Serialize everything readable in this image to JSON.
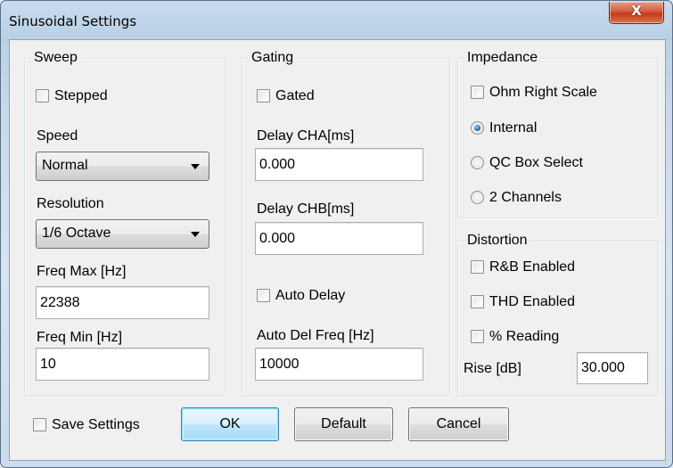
{
  "window": {
    "title": "Sinusoidal Settings",
    "close_glyph": "X"
  },
  "sweep": {
    "legend": "Sweep",
    "stepped_label": "Stepped",
    "stepped_checked": false,
    "speed_label": "Speed",
    "speed_value": "Normal",
    "resolution_label": "Resolution",
    "resolution_value": "1/6 Octave",
    "freq_max_label": "Freq Max [Hz]",
    "freq_max_value": "22388",
    "freq_min_label": "Freq Min [Hz]",
    "freq_min_value": "10"
  },
  "gating": {
    "legend": "Gating",
    "gated_label": "Gated",
    "gated_checked": false,
    "delay_cha_label": "Delay CHA[ms]",
    "delay_cha_value": "0.000",
    "delay_chb_label": "Delay CHB[ms]",
    "delay_chb_value": "0.000",
    "auto_delay_label": "Auto Delay",
    "auto_delay_checked": false,
    "auto_del_freq_label": "Auto Del Freq [Hz]",
    "auto_del_freq_value": "10000"
  },
  "impedance": {
    "legend": "Impedance",
    "ohm_right_scale_label": "Ohm Right Scale",
    "ohm_right_scale_checked": false,
    "options": [
      "Internal",
      "QC Box Select",
      "2 Channels"
    ],
    "selected": "Internal"
  },
  "distortion": {
    "legend": "Distortion",
    "rb_enabled_label": "R&B Enabled",
    "thd_enabled_label": "THD Enabled",
    "percent_reading_label": "% Reading",
    "rise_label": "Rise [dB]",
    "rise_value": "30.000"
  },
  "footer": {
    "save_settings_label": "Save Settings",
    "save_settings_checked": false,
    "ok_label": "OK",
    "default_label": "Default",
    "cancel_label": "Cancel"
  },
  "icons": {
    "dropdown": "chevron-down-icon",
    "close": "close-icon"
  }
}
